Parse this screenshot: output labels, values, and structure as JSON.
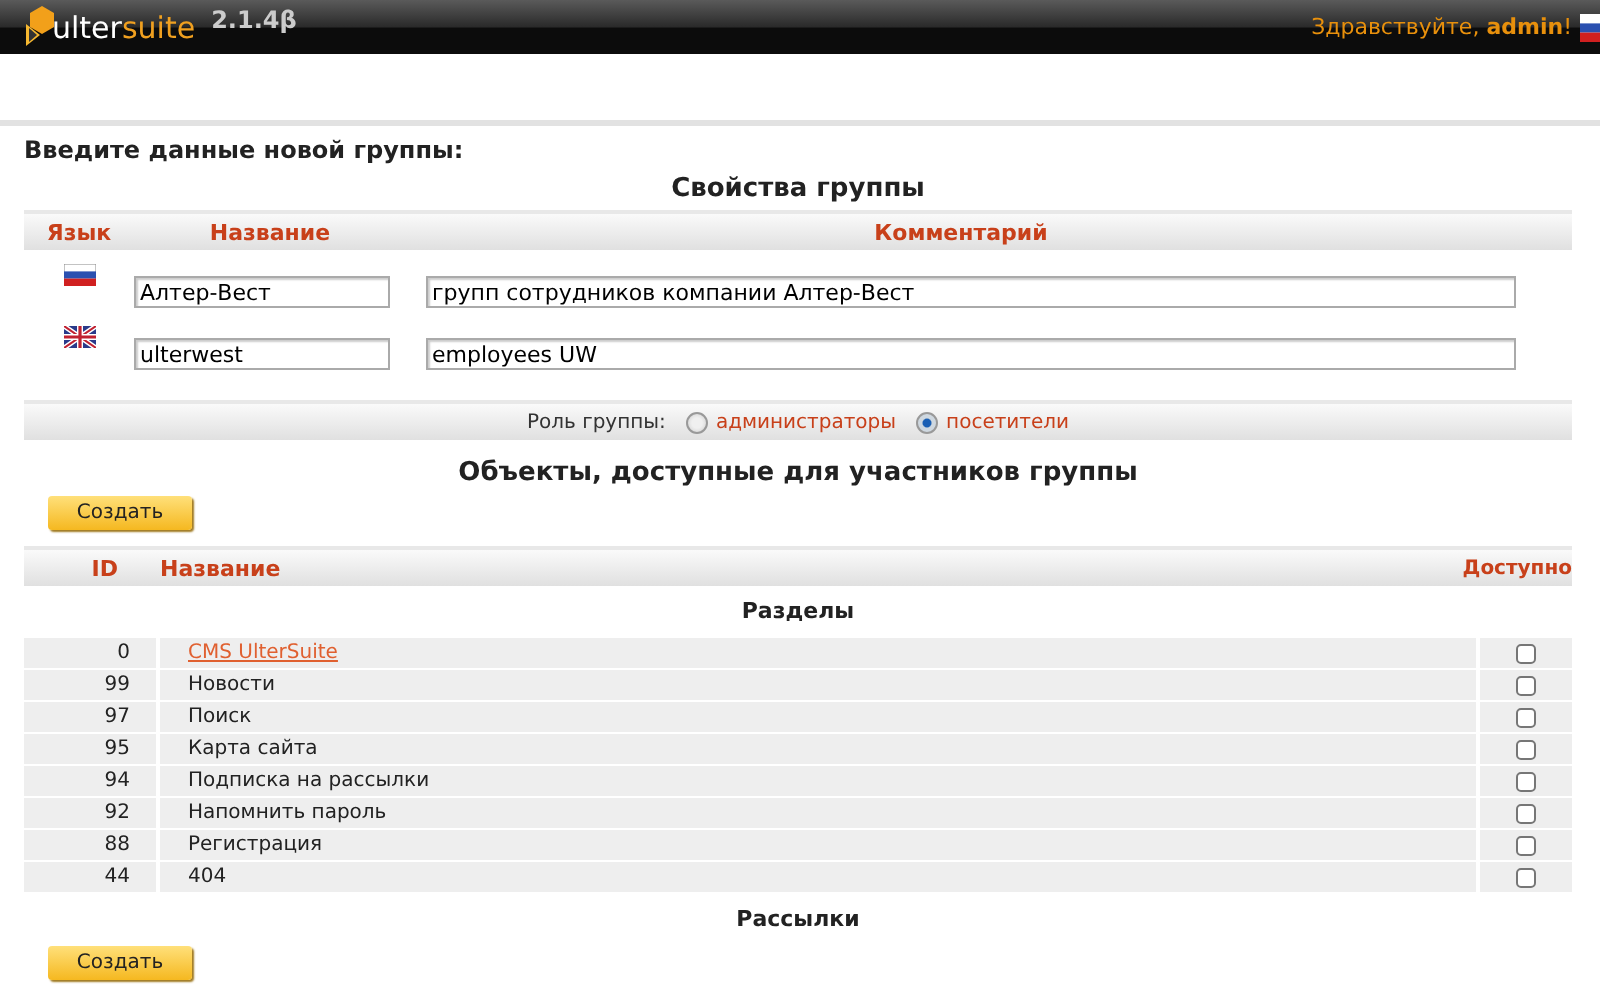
{
  "header": {
    "logo": {
      "part_1": "ulter",
      "part_2": "suite"
    },
    "version": "2.1.4β",
    "greeting": "Здравствуйте, **admin**!"
  },
  "page_title": "Введите данные новой группы:",
  "properties": {
    "title": "Свойства группы",
    "columns": [
      "Язык",
      "Название",
      "Комментарий"
    ],
    "rows": [
      {
        "kind": "ru",
        "name": "Алтер-Вест",
        "comment": "групп сотрудников компании Алтер-Вест"
      },
      {
        "kind": "en",
        "name": "ulterwest",
        "comment": "employees UW"
      }
    ]
  },
  "role": {
    "label": "Роль группы:",
    "options": [
      {
        "label": "администраторы",
        "selected": false
      },
      {
        "label": "посетители",
        "selected": true
      }
    ]
  },
  "objects": {
    "title": "Объекты, доступные для участников группы",
    "create_button": "Создать",
    "columns": [
      "ID",
      "Название",
      "Доступно"
    ],
    "sections": [
      {
        "title": "Разделы",
        "rows": [
          {
            "id": "0",
            "name": "CMS UlterSuite",
            "link": true,
            "checked": false
          },
          {
            "id": "99",
            "name": "Новости",
            "link": false,
            "checked": false
          },
          {
            "id": "97",
            "name": "Поиск",
            "link": false,
            "checked": false
          },
          {
            "id": "95",
            "name": "Карта сайта",
            "link": false,
            "checked": false
          },
          {
            "id": "94",
            "name": "Подписка на рассылки",
            "link": false,
            "checked": false
          },
          {
            "id": "92",
            "name": "Напомнить пароль",
            "link": false,
            "checked": false
          },
          {
            "id": "88",
            "name": "Регистрация",
            "link": false,
            "checked": false
          },
          {
            "id": "44",
            "name": "404",
            "link": false,
            "checked": false
          }
        ]
      },
      {
        "title": "Рассылки"
      }
    ],
    "bottom_button": "Создать"
  }
}
